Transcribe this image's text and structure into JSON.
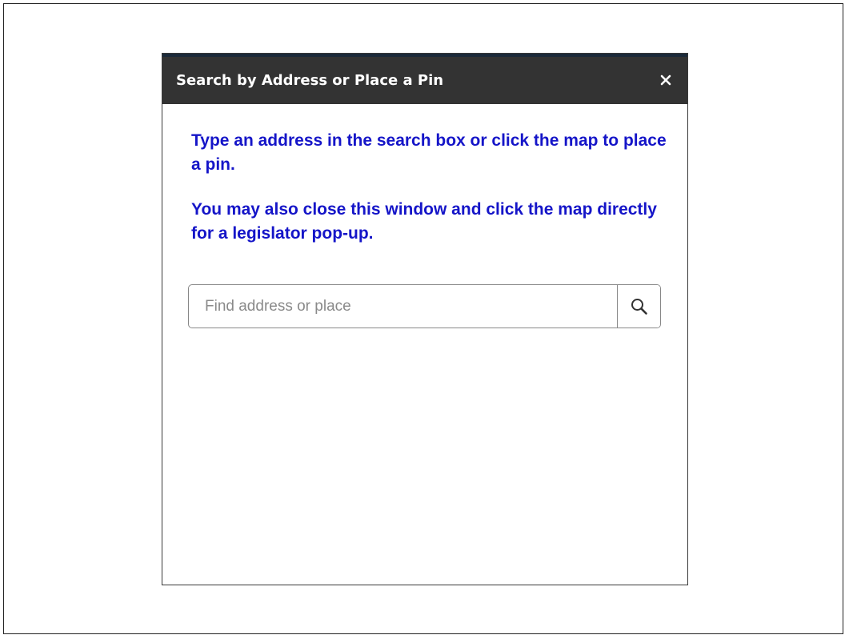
{
  "dialog": {
    "title": "Search by Address or Place a Pin",
    "close_label": "Close",
    "instructions": [
      "Type an address in the search box or click the map to place a pin.",
      "You may also close this window and click the map directly for a legislator pop-up."
    ],
    "search": {
      "placeholder": "Find address or place",
      "value": "",
      "button_label": "Search"
    }
  },
  "colors": {
    "titlebar": "#333333",
    "instruction_text": "#1515c8",
    "accent": "#1b2a3a"
  },
  "icons": {
    "close": "close-icon",
    "search": "search-icon"
  }
}
